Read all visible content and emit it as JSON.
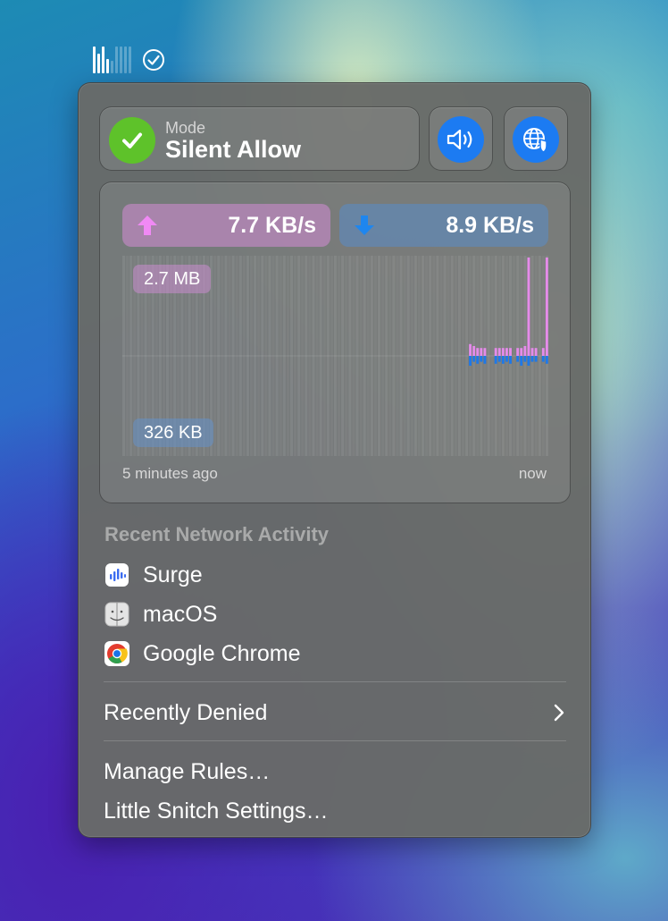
{
  "menubar": {
    "icons": [
      "network-activity-icon",
      "checkmark-circle-icon"
    ]
  },
  "mode": {
    "label": "Mode",
    "value": "Silent Allow",
    "icon": "checkmark-icon"
  },
  "buttons": [
    {
      "name": "sound-button",
      "icon": "speaker-wave-icon"
    },
    {
      "name": "network-filter-button",
      "icon": "globe-shield-icon"
    }
  ],
  "traffic": {
    "upload_rate": "7.7 KB/s",
    "download_rate": "8.9 KB/s",
    "max_upload": "2.7 MB",
    "max_download": "326 KB",
    "time_start": "5 minutes ago",
    "time_end": "now"
  },
  "chart_data": {
    "type": "bar",
    "series": [
      {
        "name": "upload",
        "values": [
          0,
          0,
          0,
          0,
          0,
          0,
          0,
          0,
          0,
          0,
          0,
          0,
          0,
          0,
          0,
          0,
          0,
          0,
          0,
          0,
          0,
          0,
          0,
          0,
          0,
          0,
          0,
          0,
          0,
          0,
          0,
          0,
          0,
          0,
          0,
          0,
          0,
          0,
          0,
          0,
          0,
          0,
          0,
          0,
          0,
          0,
          0,
          0,
          0,
          0,
          0,
          0,
          0,
          0,
          0,
          0,
          0,
          0,
          0,
          0,
          0,
          0,
          0,
          0,
          0,
          0,
          0,
          0,
          0,
          0,
          0,
          0,
          0,
          0,
          0,
          0,
          0,
          0,
          0,
          0,
          0,
          0,
          0,
          0,
          0,
          0,
          0,
          0,
          0,
          0,
          0,
          0,
          0,
          0,
          0,
          0.12,
          0.1,
          0.08,
          0.08,
          0.08,
          0,
          0,
          0.08,
          0.08,
          0.08,
          0.08,
          0.08,
          0,
          0.08,
          0.08,
          0.1,
          1.0,
          0.08,
          0.08,
          0,
          0.08,
          1.0
        ]
      },
      {
        "name": "download",
        "values": [
          0,
          0,
          0,
          0,
          0,
          0,
          0,
          0,
          0,
          0,
          0,
          0,
          0,
          0,
          0,
          0,
          0,
          0,
          0,
          0,
          0,
          0,
          0,
          0,
          0,
          0,
          0,
          0,
          0,
          0,
          0,
          0,
          0,
          0,
          0,
          0,
          0,
          0,
          0,
          0,
          0,
          0,
          0,
          0,
          0,
          0,
          0,
          0,
          0,
          0,
          0,
          0,
          0,
          0,
          0,
          0,
          0,
          0,
          0,
          0,
          0,
          0,
          0,
          0,
          0,
          0,
          0,
          0,
          0,
          0,
          0,
          0,
          0,
          0,
          0,
          0,
          0,
          0,
          0,
          0,
          0,
          0,
          0,
          0,
          0,
          0,
          0,
          0,
          0,
          0,
          0,
          0,
          0,
          0,
          0,
          0.1,
          0.06,
          0.08,
          0.06,
          0.08,
          0,
          0,
          0.08,
          0.06,
          0.08,
          0.06,
          0.08,
          0,
          0.06,
          0.1,
          0.06,
          0.1,
          0.06,
          0.06,
          0,
          0.06,
          0.08
        ]
      }
    ],
    "colors": {
      "upload": "#e58bea",
      "download": "#1e78e8"
    }
  },
  "recent": {
    "title": "Recent Network Activity",
    "apps": [
      {
        "name": "Surge",
        "icon": "surge-app-icon"
      },
      {
        "name": "macOS",
        "icon": "finder-app-icon"
      },
      {
        "name": "Google Chrome",
        "icon": "chrome-app-icon"
      }
    ]
  },
  "menu": {
    "recently_denied": "Recently Denied",
    "manage_rules": "Manage Rules…",
    "settings": "Little Snitch Settings…"
  }
}
